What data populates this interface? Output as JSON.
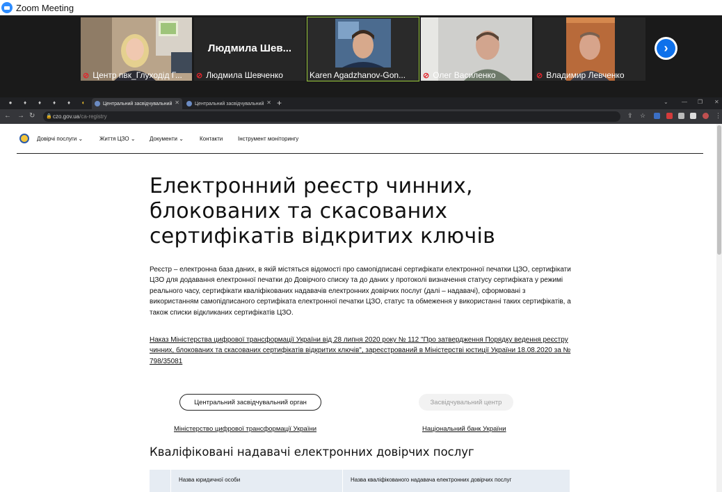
{
  "zoom": {
    "title": "Zoom Meeting"
  },
  "participants": [
    {
      "name": "Центр пвк_Глуходід Г...",
      "muted": true,
      "video": true
    },
    {
      "name": "Людмила Шевченко",
      "muted": true,
      "video": false,
      "display": "Людмила  Шев..."
    },
    {
      "name": "Karen Agadzhanov-Gon...",
      "muted": false,
      "video": true,
      "active": true
    },
    {
      "name": "Олег Василенко",
      "muted": true,
      "video": true
    },
    {
      "name": "Владимир Левченко",
      "muted": true,
      "video": true
    }
  ],
  "browser": {
    "tabs": [
      {
        "title": "Центральний засвідчувальний"
      },
      {
        "title": "Центральний засвідчувальний"
      }
    ],
    "url_host": "czo.gov.ua",
    "url_path": "/ca-registry"
  },
  "site": {
    "nav": [
      "Довірчі послуги",
      "Життя ЦЗО",
      "Документи",
      "Контакти",
      "Інструмент моніторингу"
    ],
    "nav_dropdown": [
      "⌄",
      "⌄",
      "⌄"
    ],
    "title_lines": [
      "Електронний реєстр чинних,",
      "блокованих та скасованих",
      "сертифікатів відкритих ключів"
    ],
    "description": "Реєстр – електронна база даних, в якій містяться відомості про самопідписані сертифікати електронної печатки ЦЗО, сертифікати ЦЗО для додавання електронної печатки до Довірчого списку та до даних у протоколі визначення статусу сертифіката у режимі реального часу, сертифікати кваліфікованих надавачів електронних довірчих послуг (далі – надавачі), сформовані з використанням самопідписаного сертифіката електронної печатки ЦЗО, статус та обмеження у використанні таких сертифікатів, а також списки відкликаних сертифікатів ЦЗО.",
    "law_link": "Наказ Міністерства цифрової трансформації України від 28 липня 2020 року № 112 \"Про затвердження Порядку ведення реєстру чинних, блокованих та скасованих сертифікатів відкритих ключів\", зареєстрований в Міністерстві юстиції України 18.08.2020 за № 798/35081",
    "tab_central": "Центральний засвідчувальний орган",
    "tab_ca": "Засвідчувальний центр",
    "link_mintsyfra": "Міністерство цифрової трансформації України",
    "link_nbu": "Національний банк України",
    "section_title": "Кваліфіковані надавачі електронних довірчих послуг",
    "table_headers": [
      "Назва юридичної особи",
      "Назва кваліфікованого надавача електронних довірчих послуг"
    ]
  }
}
